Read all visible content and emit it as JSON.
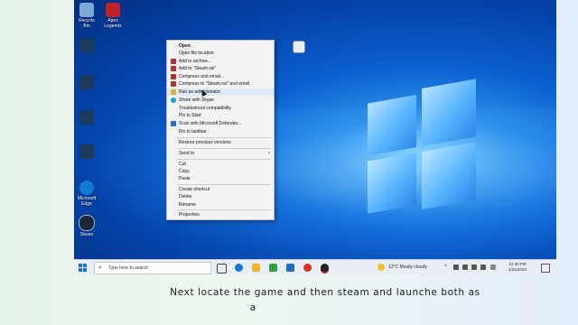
{
  "desktop": {
    "icons": [
      {
        "label": "Recycle Bin",
        "color": "#7aa8d8"
      },
      {
        "label": "Apex Legends",
        "color": "#c0202a"
      },
      {
        "label": "",
        "color": "#1b3a5c"
      },
      {
        "label": "",
        "color": "#1b3a5c"
      },
      {
        "label": "",
        "color": "#1b3a5c"
      },
      {
        "label": "",
        "color": "#1b3a5c"
      },
      {
        "label": "Microsoft Edge",
        "color": "#1479d0"
      },
      {
        "label": "Steam",
        "color": "#1b2838"
      },
      {
        "label": "",
        "color": "#e9eef5"
      }
    ]
  },
  "context_menu": {
    "items": [
      {
        "label": "Open",
        "bold": true
      },
      {
        "label": "Open file location"
      },
      {
        "label": "Add to archive..."
      },
      {
        "label": "Add to \"Steam.rar\""
      },
      {
        "label": "Compress and email..."
      },
      {
        "label": "Compress to \"Steam.rar\" and email"
      },
      {
        "label": "Run as administrator"
      },
      {
        "label": "Share with Skype"
      },
      {
        "label": "Troubleshoot compatibility"
      },
      {
        "label": "Pin to Start"
      },
      {
        "label": "Scan with Microsoft Defender..."
      },
      {
        "label": "Pin to taskbar"
      },
      {
        "label": "Restore previous versions"
      },
      {
        "label": "Send to"
      },
      {
        "label": "Cut"
      },
      {
        "label": "Copy"
      },
      {
        "label": "Paste"
      },
      {
        "label": "Create shortcut"
      },
      {
        "label": "Delete"
      },
      {
        "label": "Rename"
      },
      {
        "label": "Properties"
      }
    ],
    "highlighted_index": 6
  },
  "taskbar": {
    "search_placeholder": "Type here to search",
    "weather": "12°C  Mostly cloudy",
    "time": "12:40 PM",
    "date": "1/31/2024",
    "app_colors": [
      "#444",
      "#1479d0",
      "#f0b429",
      "#2f9e44",
      "#1b6ec2",
      "#d93025",
      "#222"
    ]
  },
  "caption": {
    "line1": "Next locate the game and then steam and launche both as",
    "line2": "a"
  }
}
